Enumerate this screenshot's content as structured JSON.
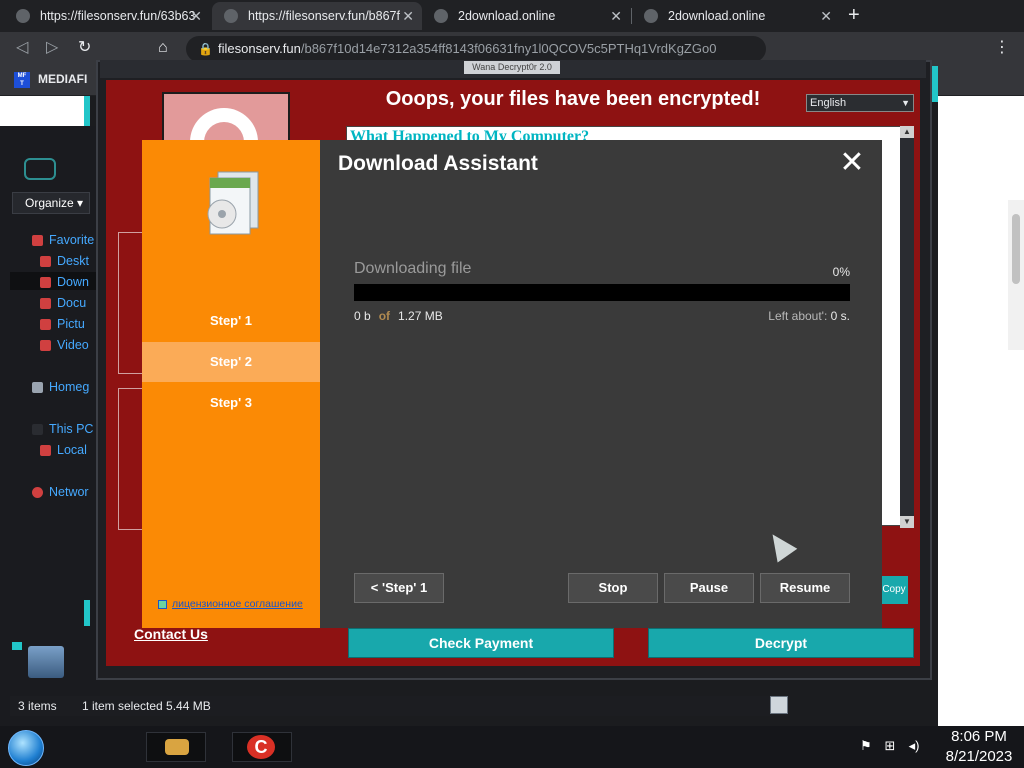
{
  "browser": {
    "tabs": [
      {
        "title": "https://filesonserv.fun/63b63",
        "active": false
      },
      {
        "title": "https://filesonserv.fun/b867f",
        "active": true
      },
      {
        "title": "2download.online",
        "active": false
      },
      {
        "title": "2download.online",
        "active": false
      }
    ],
    "url_host": "filesonserv.fun",
    "url_path": "/b867f10d14e7312a354ff8143f06631fny1l0QCOV5c5PTHq1VrdKgZGo0",
    "bookmark": "MEDIAFI"
  },
  "explorer": {
    "organize": "Organize",
    "tree": [
      {
        "label": "Favorite",
        "sub": false
      },
      {
        "label": "Deskt",
        "sub": true
      },
      {
        "label": "Down",
        "sub": true
      },
      {
        "label": "Docu",
        "sub": true
      },
      {
        "label": "Pictu",
        "sub": true
      },
      {
        "label": "Video",
        "sub": true
      },
      {
        "label": "Homeg",
        "sub": false
      },
      {
        "label": "This PC",
        "sub": false
      },
      {
        "label": "Local",
        "sub": true
      },
      {
        "label": "Networ",
        "sub": false
      }
    ],
    "status": {
      "items": "3 items",
      "selected": "1 item selected  5.44 MB"
    }
  },
  "ransom": {
    "window_title": "Wana Decrypt0r 2.0",
    "headline": "Ooops, your files have been encrypted!",
    "language": "English",
    "info_heading": "What Happened to My Computer?",
    "contact": "Contact Us",
    "check_payment": "Check Payment",
    "decrypt": "Decrypt",
    "copy": "Copy"
  },
  "download": {
    "title": "Download Assistant",
    "steps": [
      "Step' 1",
      "Step' 2",
      "Step' 3"
    ],
    "active_step": 1,
    "license": "лицензионное соглашение",
    "status_text": "Downloading file",
    "percent_label": "0%",
    "progress": 0,
    "bytes_done": "0 b",
    "of_label": "of",
    "bytes_total": "1.27 MB",
    "left_label": "Left about':",
    "left_value": "0 s.",
    "back_button": "< 'Step' 1",
    "stop_button": "Stop",
    "pause_button": "Pause",
    "resume_button": "Resume"
  },
  "taskbar": {
    "time": "8:06 PM",
    "date": "8/21/2023"
  },
  "colors": {
    "orange": "#fb8a05",
    "ransom_red": "#8e1212",
    "teal": "#18a8ac",
    "panel_dark": "#3a3a3a"
  }
}
